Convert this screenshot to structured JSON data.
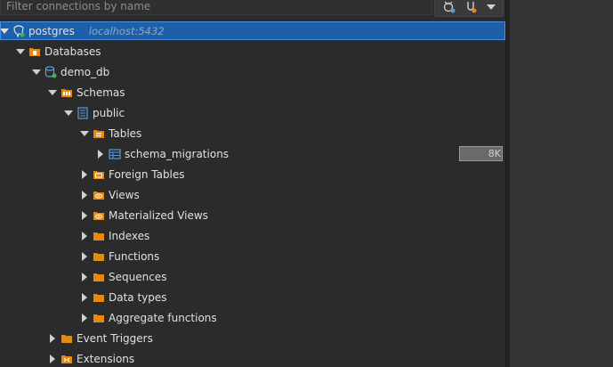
{
  "filter": {
    "placeholder": "Filter connections by name"
  },
  "toolbar": {
    "icons": [
      "connect-icon",
      "disconnect-icon",
      "dropdown-icon"
    ]
  },
  "colors": {
    "selection": "#1d5fa9",
    "folder": "#e8890c",
    "table": "#5a9bd8"
  },
  "tree": {
    "connection": {
      "label": "postgres",
      "host": "localhost:5432"
    },
    "databases": "Databases",
    "db": "demo_db",
    "schemas": "Schemas",
    "schema": "public",
    "tables": "Tables",
    "table": {
      "label": "schema_migrations",
      "size": "8K"
    },
    "foreign_tables": "Foreign Tables",
    "views": "Views",
    "materialized_views": "Materialized Views",
    "indexes": "Indexes",
    "functions": "Functions",
    "sequences": "Sequences",
    "data_types": "Data types",
    "aggregate_functions": "Aggregate functions",
    "event_triggers": "Event Triggers",
    "extensions": "Extensions"
  }
}
